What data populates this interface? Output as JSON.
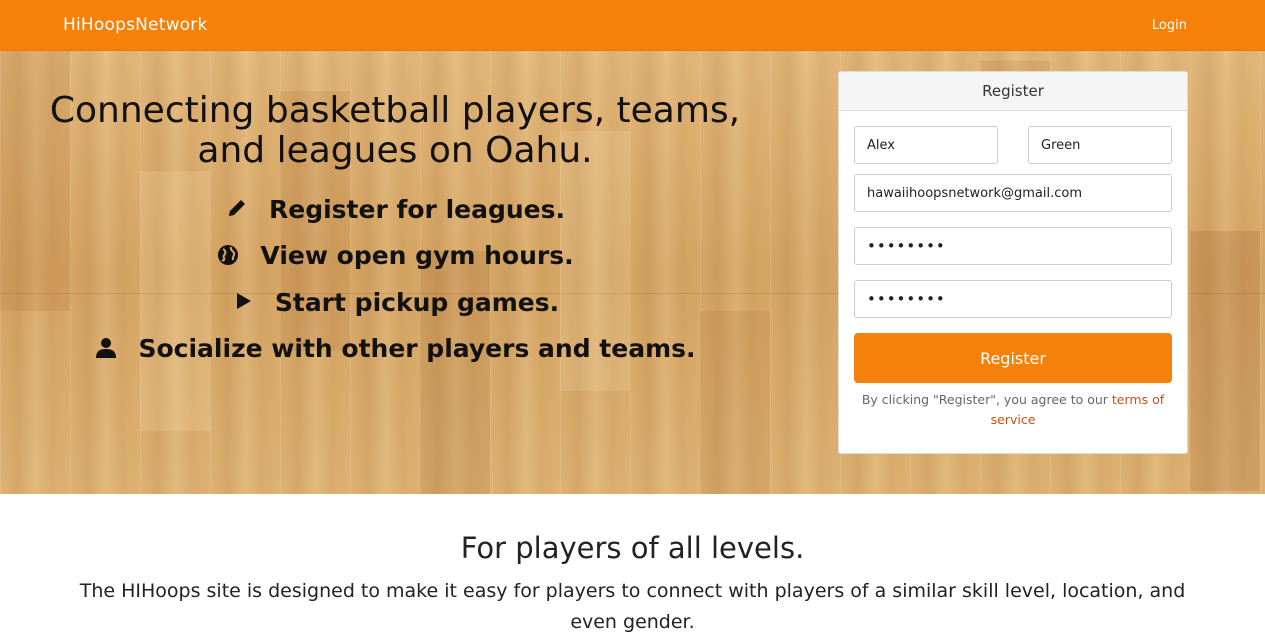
{
  "navbar": {
    "brand": "HiHoopsNetwork",
    "login_label": "Login",
    "color": "#f5800a"
  },
  "hero": {
    "title": "Connecting basketball players, teams, and leagues on Oahu.",
    "features": [
      {
        "icon": "pencil-icon",
        "label": "Register for leagues."
      },
      {
        "icon": "globe-icon",
        "label": "View open gym hours."
      },
      {
        "icon": "play-icon",
        "label": "Start pickup games."
      },
      {
        "icon": "user-icon",
        "label": "Socialize with other players and teams."
      }
    ]
  },
  "register": {
    "heading": "Register",
    "first_name": "Alex",
    "last_name": "Green",
    "email": "hawaiihoopsnetwork@gmail.com",
    "password": "••••••••",
    "confirm_password": "••••••••",
    "button_label": "Register",
    "agree_text": "By clicking \"Register\", you agree to our ",
    "terms_link": "terms of service"
  },
  "section": {
    "title": "For players of all levels.",
    "text": "The HIHoops site is designed to make it easy for players to connect with players of a similar skill level, location, and even gender."
  }
}
